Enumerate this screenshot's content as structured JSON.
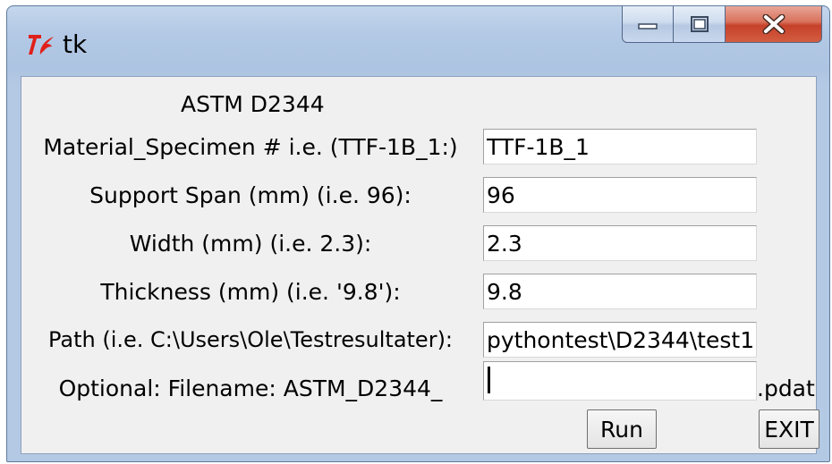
{
  "window": {
    "title": "tk",
    "icon": "tk-feather-icon",
    "controls": [
      "minimize-icon",
      "maximize-icon",
      "close-icon"
    ]
  },
  "form": {
    "heading": "ASTM D2344",
    "fields": [
      {
        "label": "Material_Specimen # i.e. (TTF-1B_1:)",
        "value": "TTF-1B_1"
      },
      {
        "label": "Support Span (mm) (i.e. 96):",
        "value": "96"
      },
      {
        "label": "Width (mm) (i.e. 2.3):",
        "value": "2.3"
      },
      {
        "label": "Thickness (mm) (i.e. '9.8'):",
        "value": "9.8"
      },
      {
        "label": "Path (i.e. C:\\Users\\Ole\\Testresultater):",
        "value": "pythontest\\D2344\\test1"
      },
      {
        "label": "Optional: Filename: ASTM_D2344_",
        "value": ""
      }
    ],
    "filename_suffix": ".pdat"
  },
  "buttons": {
    "run": "Run",
    "exit": "EXIT"
  },
  "colors": {
    "client_bg": "#f0f0f0",
    "close_button": "#c6412a",
    "icon_red": "#e0201a"
  }
}
